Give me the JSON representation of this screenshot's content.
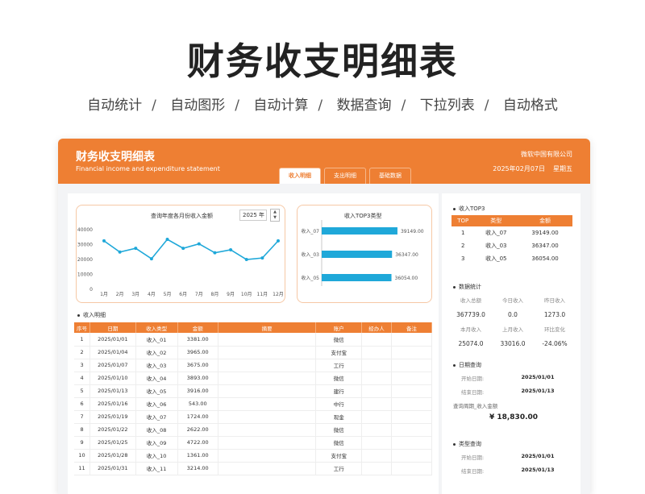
{
  "hero": {
    "title": "财务收支明细表",
    "features": [
      "自动统计",
      "自动图形",
      "自动计算",
      "数据查询",
      "下拉列表",
      "自动格式"
    ]
  },
  "header": {
    "title": "财务收支明细表",
    "subtitle": "Financial income and expenditure statement",
    "company": "微软中国有限公司",
    "date": "2025年02月07日",
    "weekday": "星期五"
  },
  "tabs": [
    {
      "label": "收入明细",
      "active": true
    },
    {
      "label": "支出明细",
      "active": false
    },
    {
      "label": "基础数据",
      "active": false
    }
  ],
  "colors": {
    "accent": "#ee7f33",
    "line": "#1fa8d9",
    "bar": "#1fa8d9"
  },
  "line_chart": {
    "title": "查询年度各月份收入金额",
    "year": "2025 年",
    "spin_up": "▲",
    "spin_down": "▼"
  },
  "bar_chart": {
    "title": "收入TOP3类型"
  },
  "chart_data": [
    {
      "type": "line",
      "title": "查询年度各月份收入金额",
      "categories": [
        "1月",
        "2月",
        "3月",
        "4月",
        "5月",
        "6月",
        "7月",
        "8月",
        "9月",
        "10月",
        "11月",
        "12月"
      ],
      "values": [
        32500,
        25000,
        27500,
        20500,
        33500,
        27500,
        30500,
        24500,
        26500,
        20000,
        21000,
        32500
      ],
      "yticks": [
        "40000",
        "30000",
        "20000",
        "10000",
        "0"
      ],
      "ylim": [
        0,
        40000
      ]
    },
    {
      "type": "bar",
      "title": "收入TOP3类型",
      "categories": [
        "收入_07",
        "收入_03",
        "收入_05"
      ],
      "values": [
        39149.0,
        36347.0,
        36054.0
      ],
      "labels": [
        "39149.00",
        "36347.00",
        "36054.00"
      ],
      "xlim": [
        0,
        45000
      ]
    }
  ],
  "detail": {
    "section_title": "收入明细",
    "headers": [
      "序号",
      "日期",
      "收入类型",
      "金额",
      "摘要",
      "账户",
      "经办人",
      "备注"
    ],
    "rows": [
      [
        "1",
        "2025/01/01",
        "收入_01",
        "3381.00",
        "",
        "微信",
        "",
        ""
      ],
      [
        "2",
        "2025/01/04",
        "收入_02",
        "3965.00",
        "",
        "支付宝",
        "",
        ""
      ],
      [
        "3",
        "2025/01/07",
        "收入_03",
        "3675.00",
        "",
        "工行",
        "",
        ""
      ],
      [
        "4",
        "2025/01/10",
        "收入_04",
        "3893.00",
        "",
        "微信",
        "",
        ""
      ],
      [
        "5",
        "2025/01/13",
        "收入_05",
        "3916.00",
        "",
        "建行",
        "",
        ""
      ],
      [
        "6",
        "2025/01/16",
        "收入_06",
        "543.00",
        "",
        "中行",
        "",
        ""
      ],
      [
        "7",
        "2025/01/19",
        "收入_07",
        "1724.00",
        "",
        "现金",
        "",
        ""
      ],
      [
        "8",
        "2025/01/22",
        "收入_08",
        "2622.00",
        "",
        "微信",
        "",
        ""
      ],
      [
        "9",
        "2025/01/25",
        "收入_09",
        "4722.00",
        "",
        "微信",
        "",
        ""
      ],
      [
        "10",
        "2025/01/28",
        "收入_10",
        "1361.00",
        "",
        "支付宝",
        "",
        ""
      ],
      [
        "11",
        "2025/01/31",
        "收入_11",
        "3214.00",
        "",
        "工行",
        "",
        ""
      ]
    ]
  },
  "top3": {
    "section_title": "收入TOP3",
    "headers": [
      "TOP",
      "类型",
      "金额"
    ],
    "rows": [
      [
        "1",
        "收入_07",
        "39149.00"
      ],
      [
        "2",
        "收入_03",
        "36347.00"
      ],
      [
        "3",
        "收入_05",
        "36054.00"
      ]
    ]
  },
  "stats": {
    "section_title": "数据统计",
    "row1_labels": [
      "收入总额",
      "今日收入",
      "昨日收入"
    ],
    "row1_values": [
      "367739.0",
      "0.0",
      "1273.0"
    ],
    "row2_labels": [
      "本月收入",
      "上月收入",
      "环比变化"
    ],
    "row2_values": [
      "25074.0",
      "33016.0",
      "-24.06%"
    ]
  },
  "date_query": {
    "section_title": "日期查询",
    "start_label": "开始日期:",
    "start_value": "2025/01/01",
    "end_label": "结束日期:",
    "end_value": "2025/01/13",
    "result_label": "查询周期_收入金额",
    "result_value": "¥ 18,830.00"
  },
  "type_query": {
    "section_title": "类型查询",
    "start_label": "开始日期:",
    "start_value": "2025/01/01",
    "end_label": "结束日期:",
    "end_value": "2025/01/13"
  }
}
